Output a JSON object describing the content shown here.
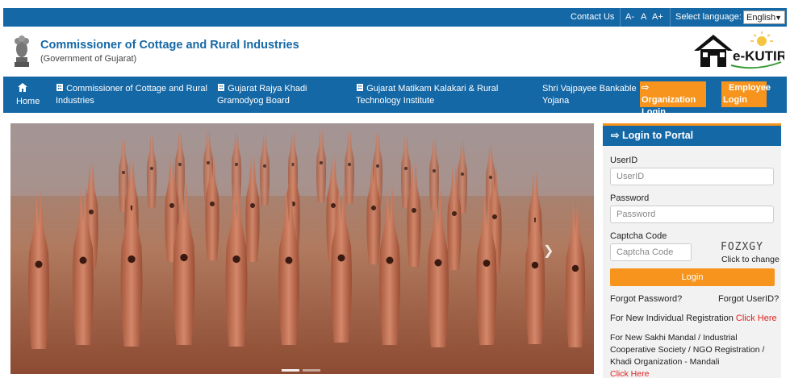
{
  "topbar": {
    "contact": "Contact Us",
    "font_small": "A-",
    "font_normal": "A",
    "font_large": "A+",
    "lang_label": "Select language:",
    "lang_value": "English"
  },
  "header": {
    "title": "Commissioner of Cottage and Rural Industries",
    "subtitle": "(Government of Gujarat)",
    "logo_text": "e-KUTIR"
  },
  "nav": {
    "home": "Home",
    "items": [
      {
        "l1": "Commissioner of Cottage and Rural",
        "l2": "Industries"
      },
      {
        "l1": "Gujarat Rajya Khadi",
        "l2": "Gramodyog Board"
      },
      {
        "l1": "Gujarat Matikam Kalakari & Rural",
        "l2": "Technology Institute"
      },
      {
        "l1": "Shri Vajpayee Bankable",
        "l2": "Yojana"
      }
    ],
    "org_login_1": "Organization",
    "org_login_2": "Login",
    "emp_login_1": "Employee",
    "emp_login_2": "Login"
  },
  "login": {
    "heading": "Login to Portal",
    "userid_label": "UserID",
    "userid_placeholder": "UserID",
    "password_label": "Password",
    "password_placeholder": "Password",
    "captcha_label": "Captcha Code",
    "captcha_placeholder": "Captcha Code",
    "captcha_value": "FOZXGY",
    "captcha_refresh": "Click to change",
    "button": "Login",
    "forgot_password": "Forgot Password?",
    "forgot_userid": "Forgot UserID?",
    "individual_text": "For New Individual Registration",
    "individual_link": "Click Here",
    "group_l1": "For New Sakhi Mandal / Industrial",
    "group_l2": "Cooperative Society / NGO Registration /",
    "group_l3": "Khadi Organization - Mandali",
    "group_link": "Click Here"
  },
  "colors": {
    "primary": "#1568a6",
    "accent": "#f7941d"
  }
}
